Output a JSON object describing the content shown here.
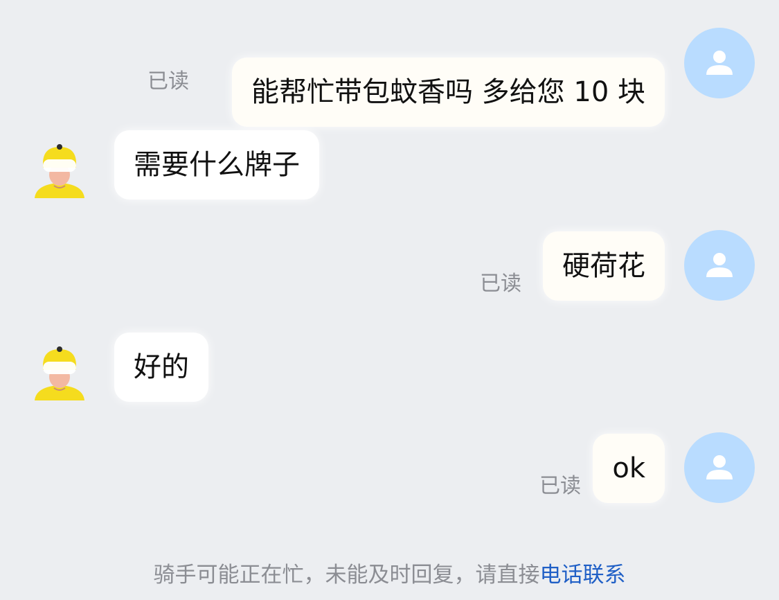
{
  "messages": [
    {
      "side": "right",
      "text": "能帮忙带包蚊香吗 多给您 10 块",
      "status": "已读"
    },
    {
      "side": "left",
      "text": "需要什么牌子"
    },
    {
      "side": "right",
      "text": "硬荷花",
      "status": "已读"
    },
    {
      "side": "left",
      "text": "好的"
    },
    {
      "side": "right",
      "text": "ok",
      "status": "已读"
    }
  ],
  "footer": {
    "prefix": "骑手可能正在忙，未能及时回复，请直接",
    "link_text": "电话联系"
  },
  "colors": {
    "background": "#eceef1",
    "user_avatar": "#b9dcff",
    "rider_helmet": "#f5dc1e",
    "link": "#1f5fc6"
  },
  "icons": {
    "user_avatar": "person-silhouette-icon",
    "rider_avatar": "rider-helmet-avatar-icon"
  }
}
